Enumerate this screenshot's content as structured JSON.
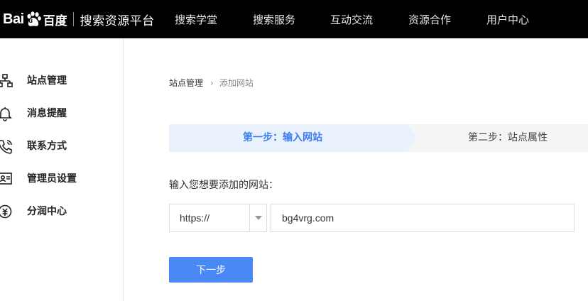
{
  "header": {
    "logo_bai": "Bai",
    "logo_du": "du",
    "logo_cn": "百度",
    "platform": "搜索资源平台",
    "nav": [
      "搜索学堂",
      "搜索服务",
      "互动交流",
      "资源合作",
      "用户中心"
    ]
  },
  "sidebar": {
    "items": [
      {
        "label": "站点管理",
        "icon": "sitemap-icon"
      },
      {
        "label": "消息提醒",
        "icon": "bell-icon"
      },
      {
        "label": "联系方式",
        "icon": "phone-icon"
      },
      {
        "label": "管理员设置",
        "icon": "admin-id-icon"
      },
      {
        "label": "分润中心",
        "icon": "revenue-icon"
      }
    ]
  },
  "breadcrumb": {
    "root": "站点管理",
    "separator": "›",
    "current": "添加网站"
  },
  "steps": {
    "step1": "第一步：输入网站",
    "step2": "第二步：站点属性"
  },
  "form": {
    "prompt": "输入您想要添加的网站：",
    "protocol": "https://",
    "url_value": "bg4vrg.com",
    "next_label": "下一步"
  },
  "colors": {
    "topbar": "#000000",
    "accent": "#4a88f5",
    "step_active_bg": "#e9f1fd",
    "step_active_text": "#3c7df0"
  }
}
